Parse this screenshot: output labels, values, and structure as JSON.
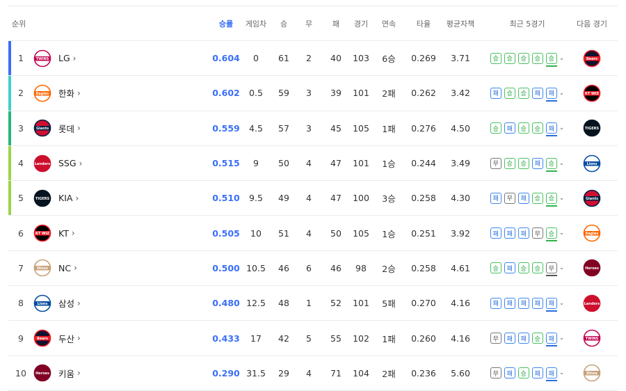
{
  "header": {
    "rank": "순위",
    "pct": "승률",
    "gb": "게임차",
    "w": "승",
    "d": "무",
    "l": "패",
    "g": "경기",
    "streak": "연속",
    "avg": "타율",
    "era": "평균자책",
    "last5": "최근 5경기",
    "next": "다음 경기"
  },
  "colors": {
    "accent": "#3a6ff7",
    "win": "#2fa84a",
    "loss": "#2a6edb",
    "draw": "#555555"
  },
  "labels": {
    "win": "승",
    "loss": "패",
    "draw": "무"
  },
  "teams": [
    {
      "rank": "1",
      "name": "LG",
      "logo": "twins",
      "bar": "#3a6ff7",
      "pct": "0.604",
      "gb": "0",
      "w": "61",
      "d": "2",
      "l": "40",
      "g": "103",
      "streak": "6승",
      "avg": "0.269",
      "era": "3.71",
      "last5": [
        "win",
        "win",
        "win",
        "win",
        "win"
      ],
      "next": "bears"
    },
    {
      "rank": "2",
      "name": "한화",
      "logo": "eagles",
      "bar": "#41cfc9",
      "pct": "0.602",
      "gb": "0.5",
      "w": "59",
      "d": "3",
      "l": "39",
      "g": "101",
      "streak": "2패",
      "avg": "0.262",
      "era": "3.42",
      "last5": [
        "loss",
        "win",
        "win",
        "loss",
        "loss"
      ],
      "next": "wiz"
    },
    {
      "rank": "3",
      "name": "롯데",
      "logo": "giants",
      "bar": "#27b47a",
      "pct": "0.559",
      "gb": "4.5",
      "w": "57",
      "d": "3",
      "l": "45",
      "g": "105",
      "streak": "1패",
      "avg": "0.276",
      "era": "4.50",
      "last5": [
        "win",
        "loss",
        "win",
        "win",
        "loss"
      ],
      "next": "tigers"
    },
    {
      "rank": "4",
      "name": "SSG",
      "logo": "landers",
      "bar": "#9ad44a",
      "pct": "0.515",
      "gb": "9",
      "w": "50",
      "d": "4",
      "l": "47",
      "g": "101",
      "streak": "1승",
      "avg": "0.244",
      "era": "3.49",
      "last5": [
        "draw",
        "win",
        "win",
        "loss",
        "win"
      ],
      "next": "lions"
    },
    {
      "rank": "5",
      "name": "KIA",
      "logo": "tigers",
      "bar": "#9ad44a",
      "pct": "0.510",
      "gb": "9.5",
      "w": "49",
      "d": "4",
      "l": "47",
      "g": "100",
      "streak": "3승",
      "avg": "0.258",
      "era": "4.30",
      "last5": [
        "loss",
        "draw",
        "loss",
        "win",
        "win"
      ],
      "next": "giants"
    },
    {
      "rank": "6",
      "name": "KT",
      "logo": "wiz",
      "bar": "",
      "pct": "0.505",
      "gb": "10",
      "w": "51",
      "d": "4",
      "l": "50",
      "g": "105",
      "streak": "1승",
      "avg": "0.251",
      "era": "3.92",
      "last5": [
        "loss",
        "loss",
        "loss",
        "draw",
        "win"
      ],
      "next": "eagles"
    },
    {
      "rank": "7",
      "name": "NC",
      "logo": "dinos",
      "bar": "",
      "pct": "0.500",
      "gb": "10.5",
      "w": "46",
      "d": "6",
      "l": "46",
      "g": "98",
      "streak": "2승",
      "avg": "0.258",
      "era": "4.61",
      "last5": [
        "win",
        "loss",
        "win",
        "win",
        "draw"
      ],
      "next": "heroes"
    },
    {
      "rank": "8",
      "name": "삼성",
      "logo": "lions",
      "bar": "",
      "pct": "0.480",
      "gb": "12.5",
      "w": "48",
      "d": "1",
      "l": "52",
      "g": "101",
      "streak": "5패",
      "avg": "0.270",
      "era": "4.16",
      "last5": [
        "loss",
        "loss",
        "loss",
        "loss",
        "loss"
      ],
      "next": "landers"
    },
    {
      "rank": "9",
      "name": "두산",
      "logo": "bears",
      "bar": "",
      "pct": "0.433",
      "gb": "17",
      "w": "42",
      "d": "5",
      "l": "55",
      "g": "102",
      "streak": "1패",
      "avg": "0.260",
      "era": "4.16",
      "last5": [
        "draw",
        "loss",
        "loss",
        "win",
        "loss"
      ],
      "next": "twins"
    },
    {
      "rank": "10",
      "name": "키움",
      "logo": "heroes",
      "bar": "",
      "pct": "0.290",
      "gb": "31.5",
      "w": "29",
      "d": "4",
      "l": "71",
      "g": "104",
      "streak": "2패",
      "avg": "0.236",
      "era": "5.60",
      "last5": [
        "draw",
        "loss",
        "win",
        "loss",
        "loss"
      ],
      "next": "dinos"
    }
  ],
  "logos": {
    "twins": {
      "word": "TWINS",
      "fg": "#c30452",
      "bg": "#ffffff",
      "ring": "#c30452",
      "icon": "twins-logo-icon"
    },
    "eagles": {
      "word": "Eagles",
      "fg": "#ff6600",
      "bg": "#ffffff",
      "ring": "#ff6600",
      "icon": "eagles-logo-icon"
    },
    "giants": {
      "word": "Giants",
      "fg": "#ffffff",
      "bg": "#d00f31",
      "ring": "#041e42",
      "icon": "giants-logo-icon"
    },
    "landers": {
      "word": "Landers",
      "fg": "#ffffff",
      "bg": "#ce0e2d",
      "ring": "#ce0e2d",
      "icon": "landers-logo-icon"
    },
    "tigers": {
      "word": "TIGERS",
      "fg": "#ea0029",
      "bg": "#06141f",
      "ring": "#06141f",
      "icon": "tigers-logo-icon"
    },
    "wiz": {
      "word": "KT WIZ",
      "fg": "#ffffff",
      "bg": "#000000",
      "ring": "#eb1c24",
      "icon": "wiz-logo-icon"
    },
    "dinos": {
      "word": "Dinos",
      "fg": "#1d467f",
      "bg": "#ffffff",
      "ring": "#c7a079",
      "icon": "dinos-logo-icon"
    },
    "lions": {
      "word": "Lions",
      "fg": "#074ca1",
      "bg": "#ffffff",
      "ring": "#074ca1",
      "icon": "lions-logo-icon"
    },
    "bears": {
      "word": "Bears",
      "fg": "#ffffff",
      "bg": "#131230",
      "ring": "#ed1c24",
      "icon": "bears-logo-icon"
    },
    "heroes": {
      "word": "Heroes",
      "fg": "#ffffff",
      "bg": "#820024",
      "ring": "#820024",
      "icon": "heroes-logo-icon"
    }
  }
}
